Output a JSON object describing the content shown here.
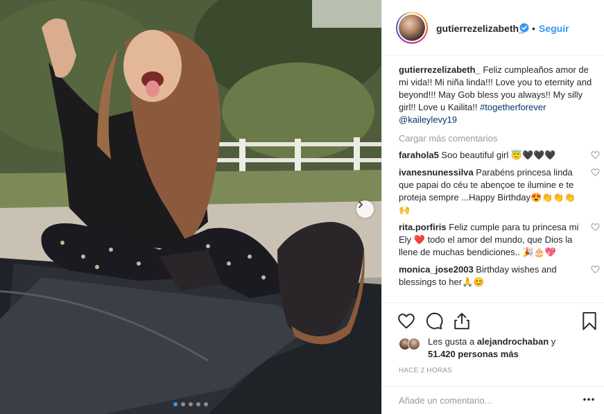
{
  "post": {
    "image_alt": "Girl sitting on a car sticking out her tongue",
    "carousel_dots": 5,
    "active_dot": 0
  },
  "header": {
    "username": "gutierrezelizabeth_",
    "separator": "•",
    "follow_label": "Seguir"
  },
  "caption": {
    "username": "gutierrezelizabeth_",
    "text": " Feliz cumpleaños amor de mi vida!! Mi niña linda!!! Love you to eternity and beyond!!! May Gob bless you always!! My silly girl!! Love u Kailita!! ",
    "hashtag": "#togetherforever",
    "mention": "@kaileylevy19"
  },
  "load_more_label": "Cargar más comentarios",
  "comments": [
    {
      "username": "farahola5",
      "text": " Soo beautiful girl 😇🖤🖤🖤"
    },
    {
      "username": "ivanesnunessilva",
      "text": " Parabéns princesa linda que papai do céu te abençoe te ilumine e te proteja sempre ...Happy Birthday😍👏👏👏🙌"
    },
    {
      "username": "rita.porfiris",
      "text": " Feliz cumple para tu princesa mi Ely ❤️ todo el amor del mundo, que Dios la llene de muchas bendiciones.. 🎉🎂💖"
    },
    {
      "username": "monica_jose2003",
      "text": " Birthday wishes and blessings to her🙏😊"
    }
  ],
  "likes": {
    "prefix": "Les gusta a ",
    "user": "alejandrochaban",
    "middle": " y ",
    "count": "51.420 personas más"
  },
  "timestamp": "HACE 2 HORAS",
  "add_comment_placeholder": "Añade un comentario...",
  "colors": {
    "accent": "#3897f0",
    "text": "#262626",
    "muted": "#999999",
    "hashtag": "#003569",
    "border": "#efefef"
  }
}
